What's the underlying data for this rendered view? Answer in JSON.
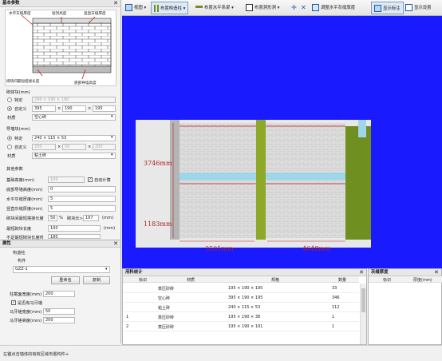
{
  "basic_params": {
    "title": "基本参数",
    "diagram_labels": {
      "horizontal_mortar": "水平灰缝厚度",
      "wall_height": "墙顶高度",
      "vertical_mortar": "竖直灰缝厚度",
      "min_cut_length": "砌块间最短搭接长度",
      "bottom_brick_height": "底部导墙高度"
    },
    "block_size_label": "砌体块(mm)",
    "radio_spec": "特定",
    "radio_custom": "自定义",
    "spec_value": "290 × 190 × 190",
    "custom_dims": [
      "395",
      "190",
      "195"
    ],
    "material_label": "材质",
    "material_value": "空心砖",
    "guide_brick_label": "导墙块(mm)",
    "guide_spec_value": "240 × 115 × 53",
    "guide_custom_dims": [
      "250",
      "50",
      "200"
    ],
    "guide_material_value": "粘土砖",
    "other_params_label": "其他参数",
    "bottom_height_label": "基础高度(mm)",
    "bottom_height_value": "100",
    "auto_calc_label": "自动计算",
    "bottom_guide_label": "底部导墙高度(mm)",
    "bottom_guide_value": "0",
    "horiz_mortar_label": "水平灰缝厚度(mm)",
    "horiz_mortar_value": "5",
    "vert_mortar_label": "竖直灰缝厚度(mm)",
    "vert_mortar_value": "5",
    "lap_label": "砌块间最短搭接长度",
    "lap_value": "50",
    "lap_unit": "%",
    "lap_extra_label": "砌块长>",
    "lap_extra_value": "197",
    "lap_extra_unit": "(mm)",
    "min_block_label": "最短砌块长度",
    "min_block_value": "100",
    "min_block_unit": "(mm)",
    "cut_length_label": "不足最短砌块长度时",
    "cut_length_value": "180"
  },
  "properties": {
    "title": "属性",
    "group_label": "构造柱",
    "component_label": "构件",
    "component_value": "GZZ-1",
    "rename_label": "重命名",
    "copy_label": "复制",
    "section_width_label": "柱截面宽度(mm)",
    "section_width_value": "200",
    "horse_teeth_label": "是否有马牙槎",
    "horse_width_label": "马牙槎宽度(mm)",
    "horse_width_value": "50",
    "horse_height_label": "马牙槎高度(mm)",
    "horse_height_value": "200"
  },
  "toolbar": {
    "view_label": "视图",
    "place_column_label": "布置构造柱",
    "place_beam_label": "布置水平系梁",
    "place_opening_label": "布置洞形洞",
    "adjust_label": "调整水平灰缝厚度",
    "show_annot_label": "显示标注",
    "show_settings_label": "显示设置"
  },
  "canvas": {
    "dim_height_1": "3746mm",
    "dim_height_2": "1183mm",
    "dim_width_1": "3501mm",
    "dim_width_2": "4648mm"
  },
  "stats": {
    "title": "用料统计",
    "headers": [
      "标识",
      "材质",
      "规格",
      "数量"
    ],
    "rows": [
      [
        "",
        "蒸压砂砖",
        "195 × 190 × 195",
        "33"
      ],
      [
        "",
        "空心砖",
        "395 × 190 × 195",
        "346"
      ],
      [
        "",
        "粘土砖",
        "240 × 115 × 53",
        "112"
      ],
      [
        "1",
        "蒸压砂砖",
        "195 × 190 × 38",
        "1"
      ],
      [
        "2",
        "蒸压砂砖",
        "195 × 190 × 191",
        "1"
      ]
    ]
  },
  "mortar": {
    "title": "灰缝厚度",
    "headers": [
      "标识",
      "厚度(mm)"
    ]
  },
  "status": {
    "text": "左键点击墙体的有效区域布置构件+"
  },
  "colors": {
    "canvas_bg": "#1a1aff",
    "wall_bg": "#d8d8d8",
    "column": "#6f8f20",
    "beam": "#9fd6e8",
    "dim": "#b02020"
  }
}
